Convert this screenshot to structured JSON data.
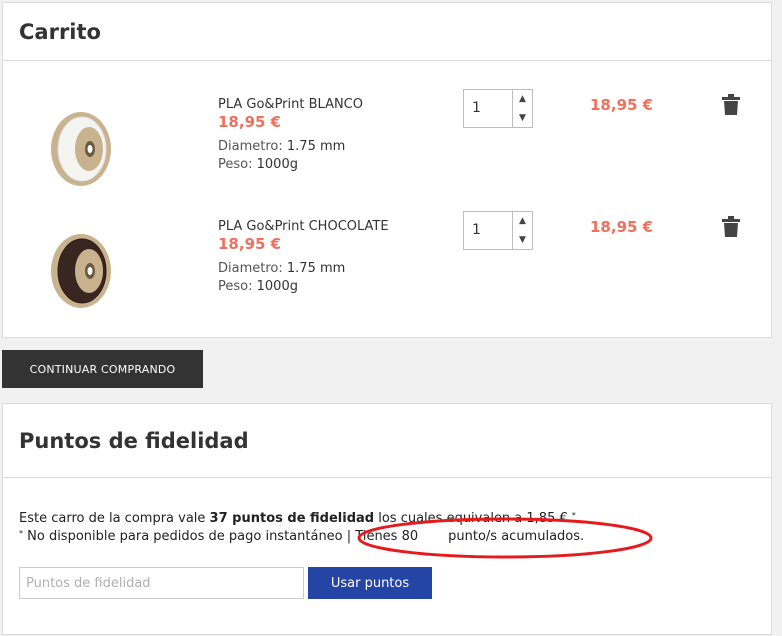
{
  "cart": {
    "title": "Carrito",
    "items": [
      {
        "name": "PLA Go&Print BLANCO",
        "price": "18,95 €",
        "attr1_label": "Diametro:",
        "attr1_value": "1.75 mm",
        "attr2_label": "Peso:",
        "attr2_value": "1000g",
        "qty": "1",
        "total": "18,95 €",
        "spool_color": "#f4f4f0"
      },
      {
        "name": "PLA Go&Print CHOCOLATE",
        "price": "18,95 €",
        "attr1_label": "Diametro:",
        "attr1_value": "1.75 mm",
        "attr2_label": "Peso:",
        "attr2_value": "1000g",
        "qty": "1",
        "total": "18,95 €",
        "spool_color": "#3a2620"
      }
    ],
    "continue_label": "CONTINUAR COMPRANDO"
  },
  "loyalty": {
    "title": "Puntos de fidelidad",
    "line1_pre": "Este carro de la compra vale ",
    "line1_bold": "37 puntos de fidelidad",
    "line1_post": " los cuales equivalen a 1,85 € ",
    "line1_mark": "*",
    "line2_mark": "*",
    "line2_main": " No disponible para pedidos de pago instantáneo",
    "line2_sep": " | ",
    "line2_have": "Tienes 80",
    "line2_tail": "punto/s acumulados.",
    "input_placeholder": "Puntos de fidelidad",
    "use_label": "Usar puntos"
  },
  "colors": {
    "price": "#f26f5c",
    "primary_button": "#2545a6",
    "dark_button": "#333333",
    "annotation": "#e8191b"
  },
  "icons": [
    "trash-icon",
    "chevron-up-icon",
    "chevron-down-icon",
    "filament-spool-image"
  ]
}
